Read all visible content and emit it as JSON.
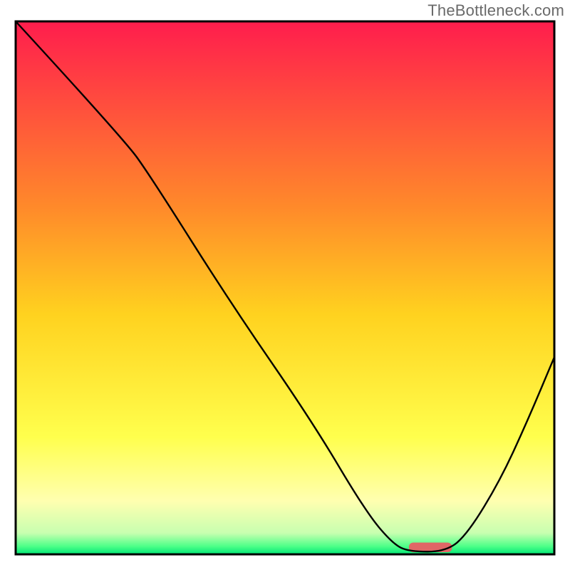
{
  "watermark": "TheBottleneck.com",
  "chart_data": {
    "type": "line",
    "title": "",
    "xlabel": "",
    "ylabel": "",
    "xlim": [
      0,
      100
    ],
    "ylim": [
      0,
      100
    ],
    "grid": false,
    "legend": false,
    "axes_visible": false,
    "background_gradient": {
      "stops": [
        {
          "offset": 0,
          "color": "#ff1d4d"
        },
        {
          "offset": 0.35,
          "color": "#ff8a2a"
        },
        {
          "offset": 0.55,
          "color": "#ffd21f"
        },
        {
          "offset": 0.78,
          "color": "#ffff4d"
        },
        {
          "offset": 0.9,
          "color": "#ffffb0"
        },
        {
          "offset": 0.96,
          "color": "#c8ffb0"
        },
        {
          "offset": 0.985,
          "color": "#4dff88"
        },
        {
          "offset": 1.0,
          "color": "#00e676"
        }
      ]
    },
    "series": [
      {
        "name": "bottleneck-curve",
        "color": "#000000",
        "points": [
          {
            "x": 0,
            "y": 100
          },
          {
            "x": 20,
            "y": 78
          },
          {
            "x": 25,
            "y": 71
          },
          {
            "x": 40,
            "y": 47
          },
          {
            "x": 55,
            "y": 25
          },
          {
            "x": 65,
            "y": 8
          },
          {
            "x": 70,
            "y": 2
          },
          {
            "x": 73,
            "y": 0.5
          },
          {
            "x": 80,
            "y": 0.5
          },
          {
            "x": 84,
            "y": 4
          },
          {
            "x": 90,
            "y": 14
          },
          {
            "x": 95,
            "y": 25
          },
          {
            "x": 100,
            "y": 37
          }
        ]
      }
    ],
    "marker": {
      "x_start": 73,
      "x_end": 81,
      "y": 1.3,
      "color": "#e06666",
      "height_pct": 1.8
    },
    "frame_color": "#000000"
  }
}
